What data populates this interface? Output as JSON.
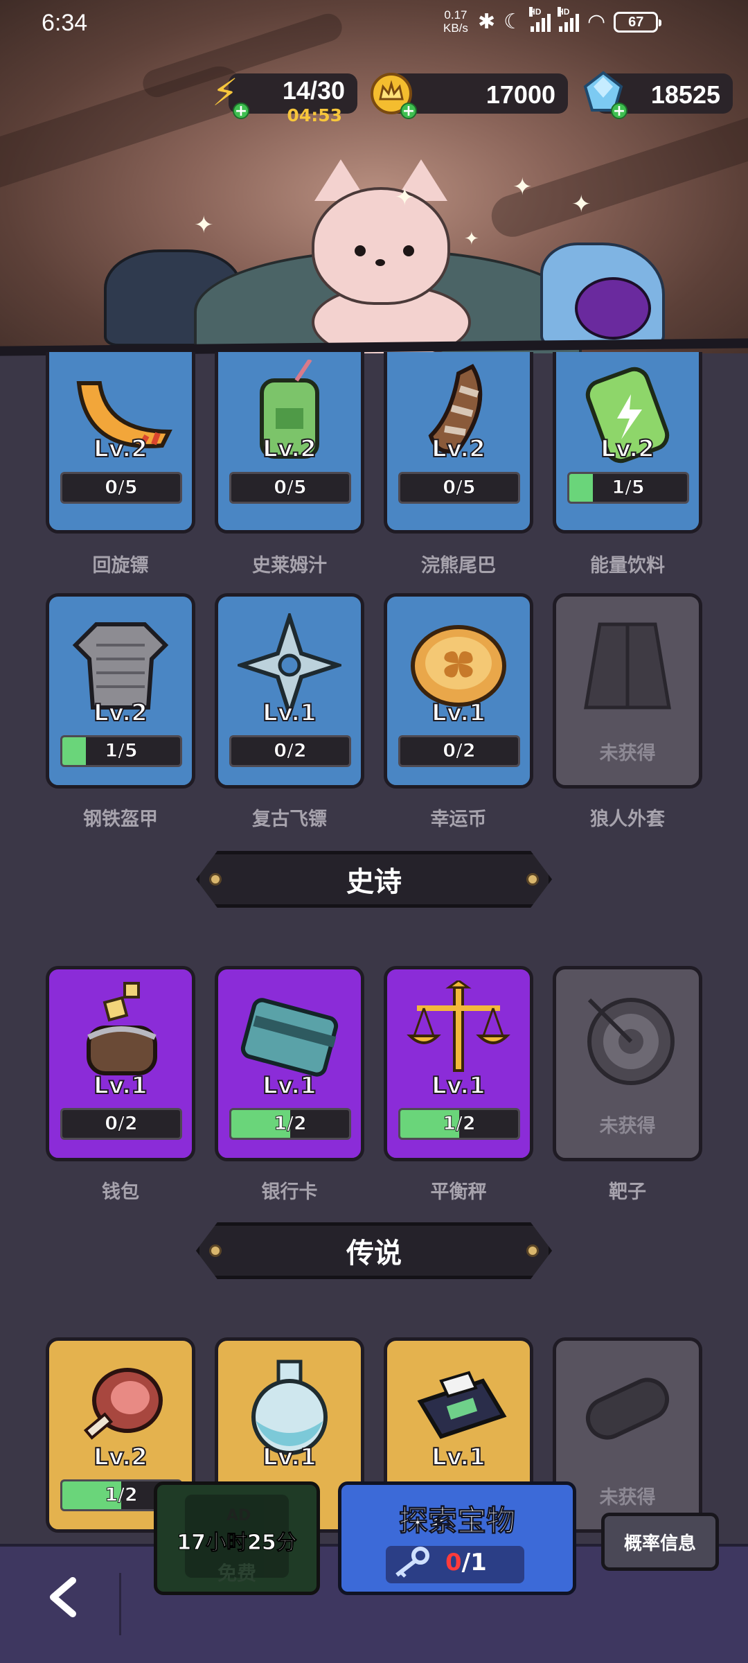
{
  "status_bar": {
    "time": "6:34",
    "net_speed_value": "0.17",
    "net_speed_unit": "KB/s",
    "battery": "67"
  },
  "resources": {
    "energy": {
      "value": "14/30",
      "timer": "04:53",
      "icon": "lightning-icon"
    },
    "gold": {
      "value": "17000",
      "icon": "crown-coin-icon"
    },
    "gems": {
      "value": "18525",
      "icon": "gem-icon"
    }
  },
  "rare_items_row1": [
    {
      "name": "回旋镖",
      "level": "Lv.2",
      "progress": "0/5",
      "fill": 0,
      "art": "boomerang"
    },
    {
      "name": "史莱姆汁",
      "level": "Lv.2",
      "progress": "0/5",
      "fill": 0,
      "art": "slime-juice"
    },
    {
      "name": "浣熊尾巴",
      "level": "Lv.2",
      "progress": "0/5",
      "fill": 0,
      "art": "raccoon-tail"
    },
    {
      "name": "能量饮料",
      "level": "Lv.2",
      "progress": "1/5",
      "fill": 0.2,
      "art": "energy-drink"
    }
  ],
  "rare_items_row2": [
    {
      "name": "钢铁盔甲",
      "level": "Lv.2",
      "progress": "1/5",
      "fill": 0.2,
      "art": "steel-armor"
    },
    {
      "name": "复古飞镖",
      "level": "Lv.1",
      "progress": "0/2",
      "fill": 0,
      "art": "shuriken"
    },
    {
      "name": "幸运币",
      "level": "Lv.1",
      "progress": "0/2",
      "fill": 0,
      "art": "lucky-coin"
    },
    {
      "name": "狼人外套",
      "locked_text": "未获得",
      "art": "werewolf-coat"
    }
  ],
  "epic_section": {
    "title": "史诗"
  },
  "epic_items": [
    {
      "name": "钱包",
      "level": "Lv.1",
      "progress": "0/2",
      "fill": 0,
      "art": "wallet"
    },
    {
      "name": "银行卡",
      "level": "Lv.1",
      "progress": "1/2",
      "fill": 0.5,
      "art": "bank-card"
    },
    {
      "name": "平衡秤",
      "level": "Lv.1",
      "progress": "1/2",
      "fill": 0.5,
      "art": "balance-scale"
    },
    {
      "name": "靶子",
      "locked_text": "未获得",
      "art": "target"
    }
  ],
  "legend_section": {
    "title": "传说"
  },
  "legend_items": [
    {
      "level": "Lv.2",
      "progress": "1/2",
      "fill": 0.5,
      "art": "meat"
    },
    {
      "level": "Lv.1",
      "art": "potion"
    },
    {
      "level": "Lv.1",
      "art": "pos-terminal"
    },
    {
      "locked_text": "未获得",
      "art": "capsule"
    }
  ],
  "bottom": {
    "ad_button": {
      "timer": "17小时25分",
      "ghost_label": "AD",
      "ghost_free": "免费"
    },
    "explore_button": {
      "title": "探索宝物",
      "count_current": "0",
      "count_total": "/1"
    },
    "probability_button": "概率信息"
  },
  "colors": {
    "rare": "#4a86c4",
    "epic": "#8b2cd8",
    "legendary": "#e4b24e",
    "locked": "#58535f",
    "progress_fill": "#6ad57a",
    "explore_button": "#3c6ad8"
  }
}
